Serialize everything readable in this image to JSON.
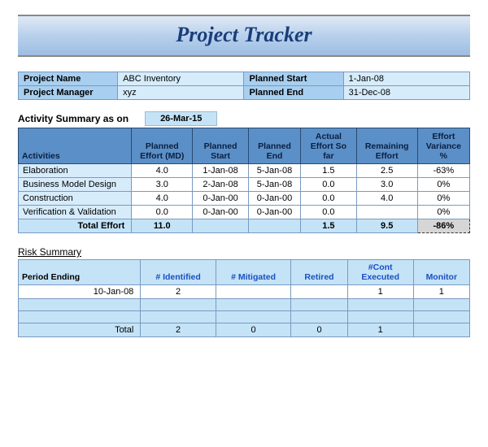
{
  "title": "Project Tracker",
  "info": {
    "projectNameLabel": "Project Name",
    "projectNameValue": "ABC Inventory",
    "plannedStartLabel": "Planned Start",
    "plannedStartValue": "1-Jan-08",
    "projectManagerLabel": "Project Manager",
    "projectManagerValue": "xyz",
    "plannedEndLabel": "Planned End",
    "plannedEndValue": "31-Dec-08"
  },
  "activitySummary": {
    "label": "Activity Summary as on",
    "date": "26-Mar-15",
    "headers": {
      "activities": "Activities",
      "plannedEffort": "Planned Effort (MD)",
      "plannedStart": "Planned Start",
      "plannedEnd": "Planned End",
      "actualEffort": "Actual Effort So far",
      "remaining": "Remaining Effort",
      "variance": "Effort Variance %"
    },
    "rows": [
      {
        "name": "Elaboration",
        "pe": "4.0",
        "ps": "1-Jan-08",
        "pend": "5-Jan-08",
        "ae": "1.5",
        "re": "2.5",
        "var": "-63%"
      },
      {
        "name": "Business Model Design",
        "pe": "3.0",
        "ps": "2-Jan-08",
        "pend": "5-Jan-08",
        "ae": "0.0",
        "re": "3.0",
        "var": "0%"
      },
      {
        "name": "Construction",
        "pe": "4.0",
        "ps": "0-Jan-00",
        "pend": "0-Jan-00",
        "ae": "0.0",
        "re": "4.0",
        "var": "0%"
      },
      {
        "name": "Verification & Validation",
        "pe": "0.0",
        "ps": "0-Jan-00",
        "pend": "0-Jan-00",
        "ae": "0.0",
        "re": "",
        "var": "0%"
      }
    ],
    "total": {
      "label": "Total Effort",
      "pe": "11.0",
      "ae": "1.5",
      "re": "9.5",
      "var": "-86%"
    }
  },
  "riskSummary": {
    "label": "Risk Summary",
    "headers": {
      "period": "Period Ending",
      "identified": "# Identified",
      "mitigated": "# Mitigated",
      "retired": "Retired",
      "cont": "#Cont Executed",
      "monitor": "Monitor"
    },
    "rows": [
      {
        "period": "10-Jan-08",
        "ident": "2",
        "mit": "",
        "ret": "",
        "cont": "1",
        "mon": "1"
      }
    ],
    "total": {
      "label": "Total",
      "ident": "2",
      "mit": "0",
      "ret": "0",
      "cont": "1",
      "mon": ""
    }
  },
  "chart_data": [
    {
      "type": "table",
      "title": "Activity Summary as on 26-Mar-15",
      "columns": [
        "Activities",
        "Planned Effort (MD)",
        "Planned Start",
        "Planned End",
        "Actual Effort So far",
        "Remaining Effort",
        "Effort Variance %"
      ],
      "rows": [
        [
          "Elaboration",
          4.0,
          "1-Jan-08",
          "5-Jan-08",
          1.5,
          2.5,
          "-63%"
        ],
        [
          "Business Model Design",
          3.0,
          "2-Jan-08",
          "5-Jan-08",
          0.0,
          3.0,
          "0%"
        ],
        [
          "Construction",
          4.0,
          "0-Jan-00",
          "0-Jan-00",
          0.0,
          4.0,
          "0%"
        ],
        [
          "Verification & Validation",
          0.0,
          "0-Jan-00",
          "0-Jan-00",
          0.0,
          null,
          "0%"
        ],
        [
          "Total Effort",
          11.0,
          null,
          null,
          1.5,
          9.5,
          "-86%"
        ]
      ]
    },
    {
      "type": "table",
      "title": "Risk Summary",
      "columns": [
        "Period Ending",
        "# Identified",
        "# Mitigated",
        "Retired",
        "#Cont Executed",
        "Monitor"
      ],
      "rows": [
        [
          "10-Jan-08",
          2,
          null,
          null,
          1,
          1
        ],
        [
          "Total",
          2,
          0,
          0,
          1,
          null
        ]
      ]
    }
  ]
}
